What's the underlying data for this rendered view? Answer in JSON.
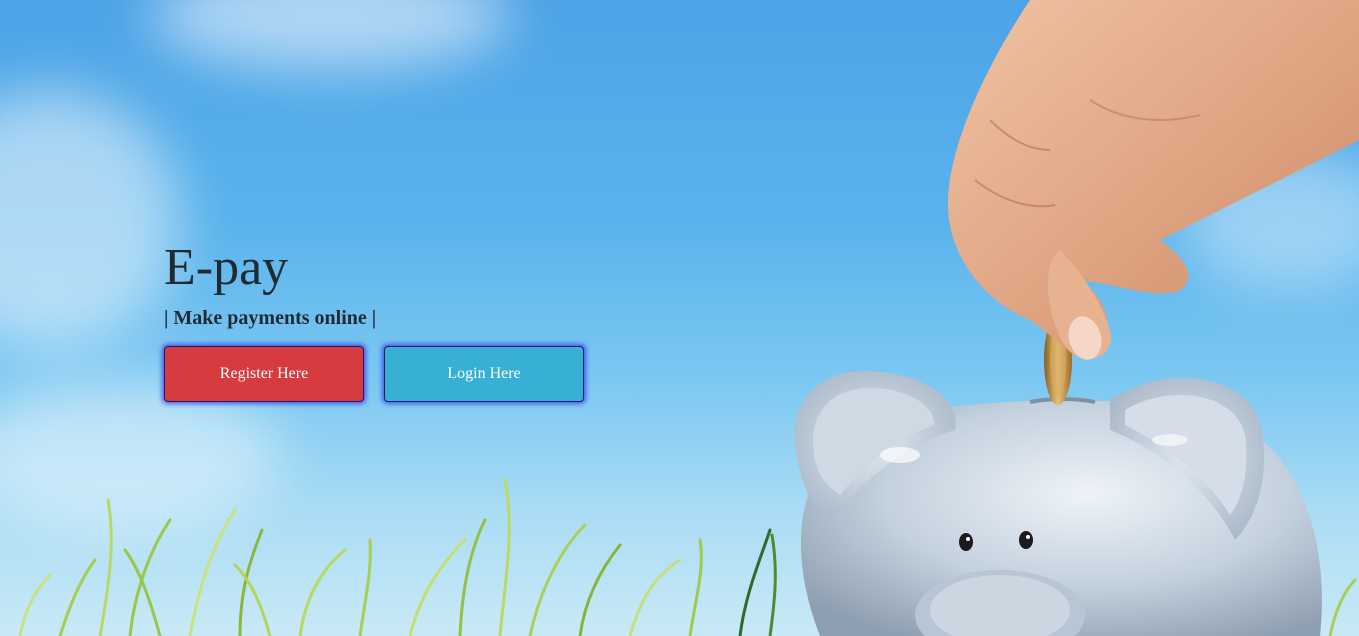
{
  "hero": {
    "title": "E-pay",
    "tagline": "| Make payments online |"
  },
  "actions": {
    "register_label": "Register Here",
    "login_label": "Login Here"
  },
  "colors": {
    "register_button": "#d63b3f",
    "login_button": "#38afd5",
    "sky": "#5ab3ec"
  },
  "background": {
    "icons": [
      "hand-with-coin-icon",
      "piggy-bank-icon",
      "grass-icon"
    ]
  }
}
